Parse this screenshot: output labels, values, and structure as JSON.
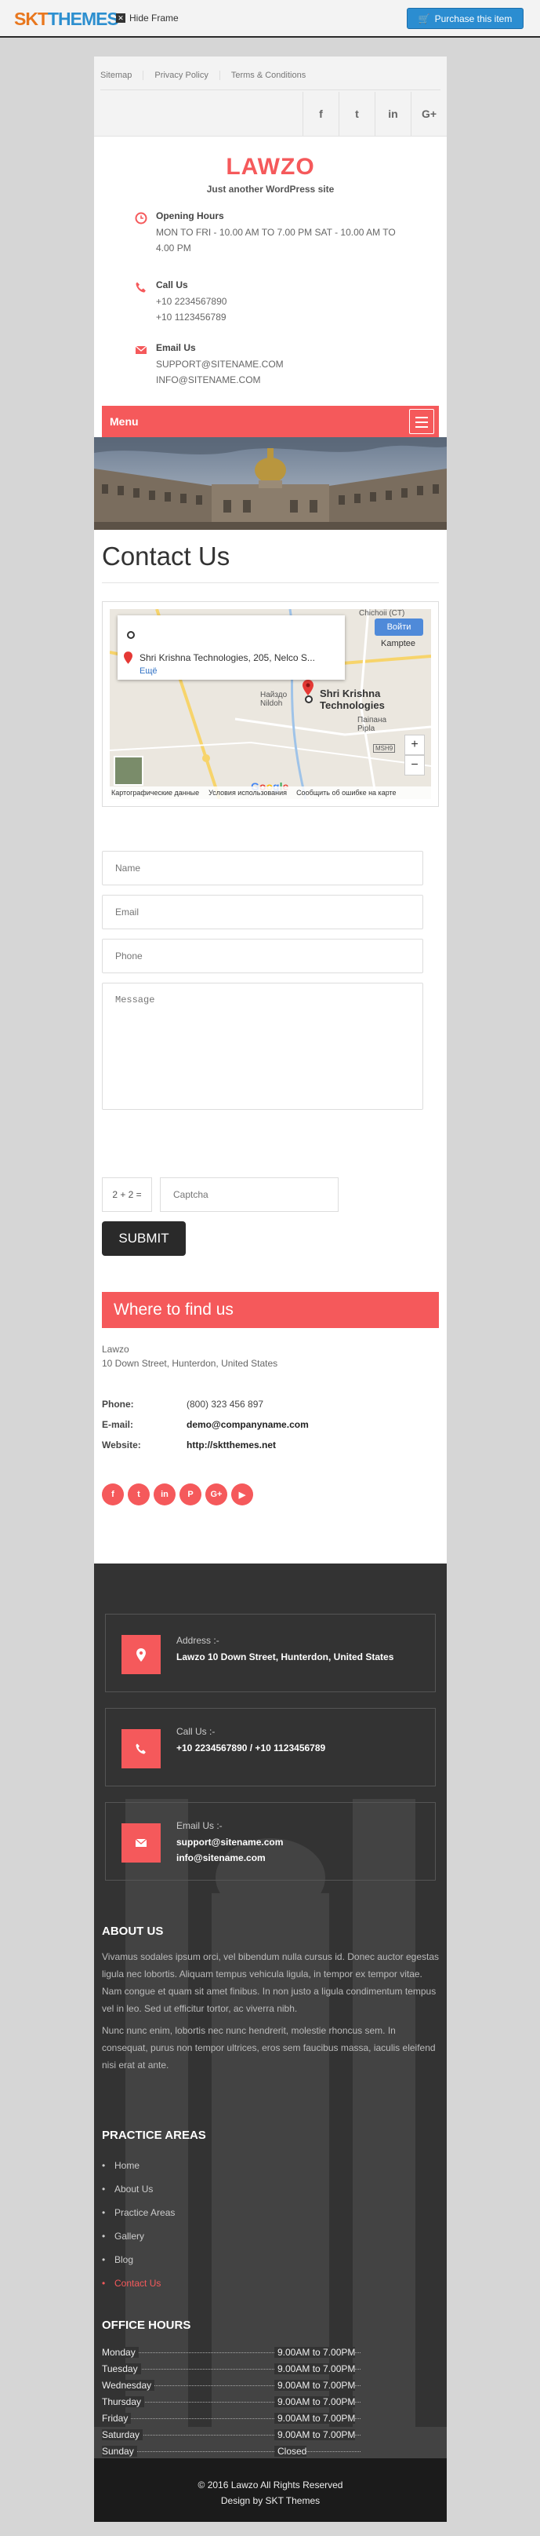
{
  "preview_bar": {
    "brand_prefix": "SKT",
    "brand_suffix": "THEMES",
    "hide_frame": "Hide Frame",
    "purchase": "Purchase this item"
  },
  "header": {
    "links": [
      "Sitemap",
      "Privacy Policy",
      "Terms & Conditions"
    ],
    "social_icons": [
      "facebook-icon",
      "twitter-icon",
      "linkedin-icon",
      "google-plus-icon"
    ],
    "social_glyphs": [
      "f",
      "t",
      "in",
      "G+"
    ],
    "site_title": "LAWZO",
    "tagline": "Just another WordPress site",
    "opening_title": "Opening Hours",
    "opening_value": "MON TO FRI - 10.00 AM TO 7.00 PM SAT - 10.00 AM TO 4.00 PM",
    "call_title": "Call Us",
    "call_1": "+10 2234567890",
    "call_2": "+10 1123456789",
    "email_title": "Email Us",
    "email_1": "SUPPORT@SITENAME.COM",
    "email_2": "INFO@SITENAME.COM",
    "menu_label": "Menu"
  },
  "main": {
    "title": "Contact Us",
    "map": {
      "address": "Shri Krishna Technologies, 205, Nelco S...",
      "link": "Ещё",
      "go_button": "Войти",
      "business": "Shri Krishna Technologies",
      "labels": [
        "Chichoii (CT)",
        "Kamptee",
        "Найздо Nildoh",
        "Паіпана Pipla",
        "MSH9"
      ],
      "footer": [
        "Картографические данные",
        "Условия использования",
        "Сообщить об ошибке на карте"
      ],
      "google": "Google"
    },
    "form": {
      "name_placeholder": "Name",
      "email_placeholder": "Email",
      "phone_placeholder": "Phone",
      "message_placeholder": "Message",
      "captcha_question": "2 + 2 =",
      "captcha_placeholder": "Captcha",
      "submit": "SUBMIT"
    },
    "find": {
      "heading": "Where to find us",
      "name": "Lawzo",
      "address": "10 Down Street, Hunterdon, United States",
      "phone_label": "Phone:",
      "phone": "(800) 323 456 897",
      "email_label": "E-mail:",
      "email": "demo@companyname.com",
      "website_label": "Website:",
      "website": "http://sktthemes.net",
      "social_glyphs": [
        "f",
        "t",
        "in",
        "P",
        "G+",
        "▶"
      ]
    }
  },
  "footer": {
    "address_label": "Address :-",
    "address_value": "Lawzo 10 Down Street, Hunterdon, United States",
    "call_label": "Call Us :-",
    "call_value": "+10 2234567890 / +10 1123456789",
    "email_label": "Email Us :-",
    "email_1": "support@sitename.com",
    "email_2": "info@sitename.com",
    "about_heading": "ABOUT US",
    "about_p1": "Vivamus sodales ipsum orci, vel bibendum nulla cursus id. Donec auctor egestas ligula nec lobortis. Aliquam tempus vehicula ligula, in tempor ex tempor vitae. Nam congue et quam sit amet finibus. In non justo a ligula condimentum tempus vel in leo. Sed ut efficitur tortor, ac viverra nibh.",
    "about_p2": "Nunc nunc enim, lobortis nec nunc hendrerit, molestie rhoncus sem. In consequat, purus non tempor ultrices, eros sem faucibus massa, iaculis eleifend nisi erat at ante.",
    "practice_heading": "PRACTICE AREAS",
    "practice_items": [
      "Home",
      "About Us",
      "Practice Areas",
      "Gallery",
      "Blog",
      "Contact Us"
    ],
    "office_heading": "OFFICE HOURS",
    "hours": [
      {
        "day": "Monday",
        "time": "9.00AM to 7.00PM"
      },
      {
        "day": "Tuesday",
        "time": "9.00AM to 7.00PM"
      },
      {
        "day": "Wednesday",
        "time": "9.00AM to 7.00PM"
      },
      {
        "day": "Thursday",
        "time": "9.00AM to 7.00PM"
      },
      {
        "day": "Friday",
        "time": "9.00AM to 7.00PM"
      },
      {
        "day": "Saturday",
        "time": "9.00AM to 7.00PM"
      },
      {
        "day": "Sunday",
        "time": "Closed"
      }
    ],
    "copyright": "© 2016 Lawzo All Rights Reserved",
    "design": "Design by SKT Themes"
  },
  "colors": {
    "accent": "#f5595b",
    "dark": "#333333",
    "brand_orange": "#e8771e",
    "brand_blue": "#2d8fcf"
  }
}
